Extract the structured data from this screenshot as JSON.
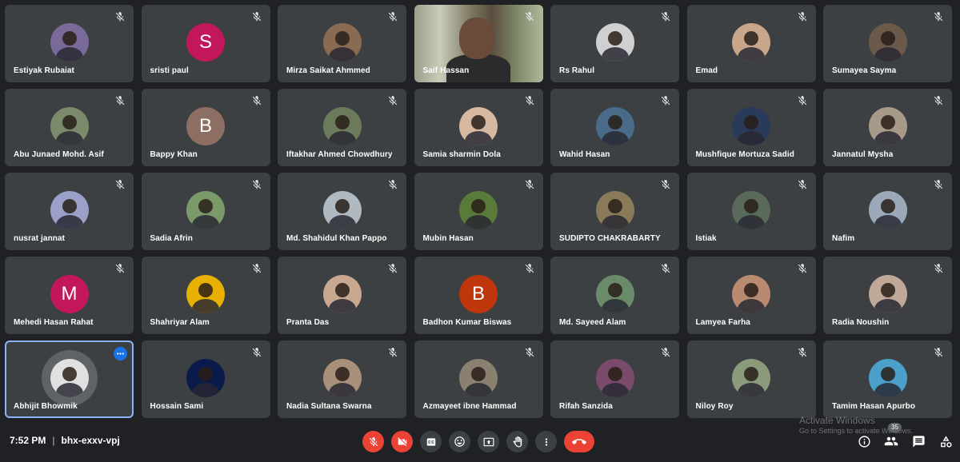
{
  "participants": [
    {
      "name": "Estiyak Rubaiat",
      "avatar_color": "#7a6a9a",
      "photo": true
    },
    {
      "name": "sristi paul",
      "initial": "S",
      "avatar_color": "#c2185b"
    },
    {
      "name": "Mirza Saikat Ahmmed",
      "avatar_color": "#8a6a50",
      "photo": true
    },
    {
      "name": "Saif Hassan",
      "video": true
    },
    {
      "name": "Rs Rahul",
      "avatar_color": "#d0d0d0",
      "photo": true
    },
    {
      "name": "Emad",
      "avatar_color": "#c9a58a",
      "photo": true
    },
    {
      "name": "Sumayea Sayma",
      "avatar_color": "#6b5a4a",
      "photo": true
    },
    {
      "name": "Abu Junaed Mohd. Asif",
      "avatar_color": "#7a8a6a",
      "photo": true
    },
    {
      "name": "Bappy Khan",
      "initial": "B",
      "avatar_color": "#8d6e63"
    },
    {
      "name": "Iftakhar Ahmed Chowdhury",
      "avatar_color": "#6a7a5a",
      "photo": true
    },
    {
      "name": "Samia sharmin Dola",
      "avatar_color": "#d7b8a0",
      "photo": true
    },
    {
      "name": "Wahid Hasan",
      "avatar_color": "#4a6a8a",
      "photo": true
    },
    {
      "name": "Mushfique Mortuza Sadid",
      "avatar_color": "#2a3a5a",
      "photo": true
    },
    {
      "name": "Jannatul Mysha",
      "avatar_color": "#a89a88",
      "photo": true
    },
    {
      "name": "nusrat jannat",
      "avatar_color": "#9aa0c8",
      "photo": true
    },
    {
      "name": "Sadia Afrin",
      "avatar_color": "#7a9a6a",
      "photo": true
    },
    {
      "name": "Md. Shahidul Khan Pappo",
      "avatar_color": "#b0b8c0",
      "photo": true
    },
    {
      "name": "Mubin Hasan",
      "avatar_color": "#5a7a3a",
      "photo": true
    },
    {
      "name": "SUDIPTO CHAKRABARTY",
      "avatar_color": "#8a7a5a",
      "photo": true
    },
    {
      "name": "Istiak",
      "avatar_color": "#5a6a5a",
      "photo": true
    },
    {
      "name": "Nafim",
      "avatar_color": "#9aa8b8",
      "photo": true
    },
    {
      "name": "Mehedi Hasan Rahat",
      "initial": "M",
      "avatar_color": "#c2185b"
    },
    {
      "name": "Shahriyar Alam",
      "avatar_color": "#e8b000",
      "photo": true
    },
    {
      "name": "Pranta Das",
      "avatar_color": "#c8a890",
      "photo": true
    },
    {
      "name": "Badhon Kumar Biswas",
      "initial": "B",
      "avatar_color": "#bf360c"
    },
    {
      "name": "Md. Sayeed Alam",
      "avatar_color": "#6a8a6a",
      "photo": true
    },
    {
      "name": "Lamyea Farha",
      "avatar_color": "#b88a70",
      "photo": true
    },
    {
      "name": "Radia Noushin",
      "avatar_color": "#c0a898",
      "photo": true
    },
    {
      "name": "Abhijit Bhowmik",
      "avatar_color": "#e0e0e0",
      "photo": true,
      "active": true
    },
    {
      "name": "Hossain Sami",
      "avatar_color": "#0a1a4a",
      "photo": true
    },
    {
      "name": "Nadia Sultana Swarna",
      "avatar_color": "#a8907a",
      "photo": true
    },
    {
      "name": "Azmayeet ibne Hammad",
      "avatar_color": "#8a8070",
      "photo": true
    },
    {
      "name": "Rifah Sanzida",
      "avatar_color": "#7a4a6a",
      "photo": true
    },
    {
      "name": "Niloy Roy",
      "avatar_color": "#8a9a7a",
      "photo": true
    },
    {
      "name": "Tamim Hasan Apurbo",
      "avatar_color": "#4aa0c8",
      "photo": true
    }
  ],
  "meeting": {
    "time": "7:52 PM",
    "separator": "|",
    "code": "bhx-exxv-vpj"
  },
  "people_count": "35",
  "watermark": {
    "title": "Activate Windows",
    "subtitle": "Go to Settings to activate Windows."
  },
  "colors": {
    "tile_bg": "#3c4043",
    "page_bg": "#202124",
    "danger": "#ea4335",
    "accent": "#8ab4f8"
  }
}
